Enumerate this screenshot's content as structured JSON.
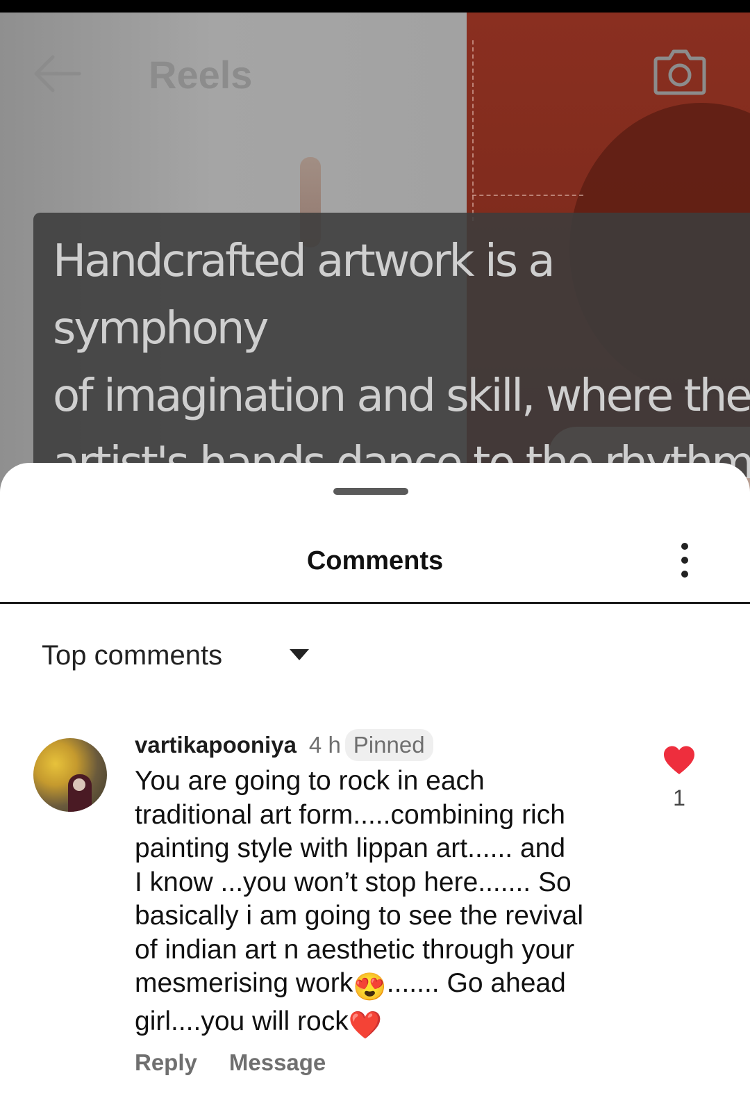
{
  "header": {
    "title": "Reels",
    "back_icon": "back-arrow-icon",
    "camera_icon": "camera-icon"
  },
  "video": {
    "caption_lines": "Handcrafted artwork is a symphony\nof imagination and skill, where the\nartist's hands dance to the rhythm\nof their creative spirit"
  },
  "sheet": {
    "title": "Comments",
    "more_icon": "more-vertical-icon",
    "sort_label": "Top comments",
    "sort_icon": "caret-down-icon"
  },
  "comment": {
    "username": "vartikapooniya",
    "time": "4 h",
    "pinned_label": "Pinned",
    "text_part1": "You are going to rock in each\ntraditional art form.....combining rich\npainting style with lippan art...... and\nI know ...you won’t stop here....... So\nbasically i am going to see the revival\nof indian art n aesthetic through your\nmesmerising work",
    "emoji_1": "😍",
    "text_part2": "....... Go ahead\ngirl....you will rock",
    "emoji_2": "❤️",
    "like_count": "1",
    "reply_label": "Reply",
    "message_label": "Message"
  },
  "colors": {
    "like": "#ee2e3d",
    "caption_bg": "#3c3c3c",
    "video_panel": "#7c2a1c"
  }
}
